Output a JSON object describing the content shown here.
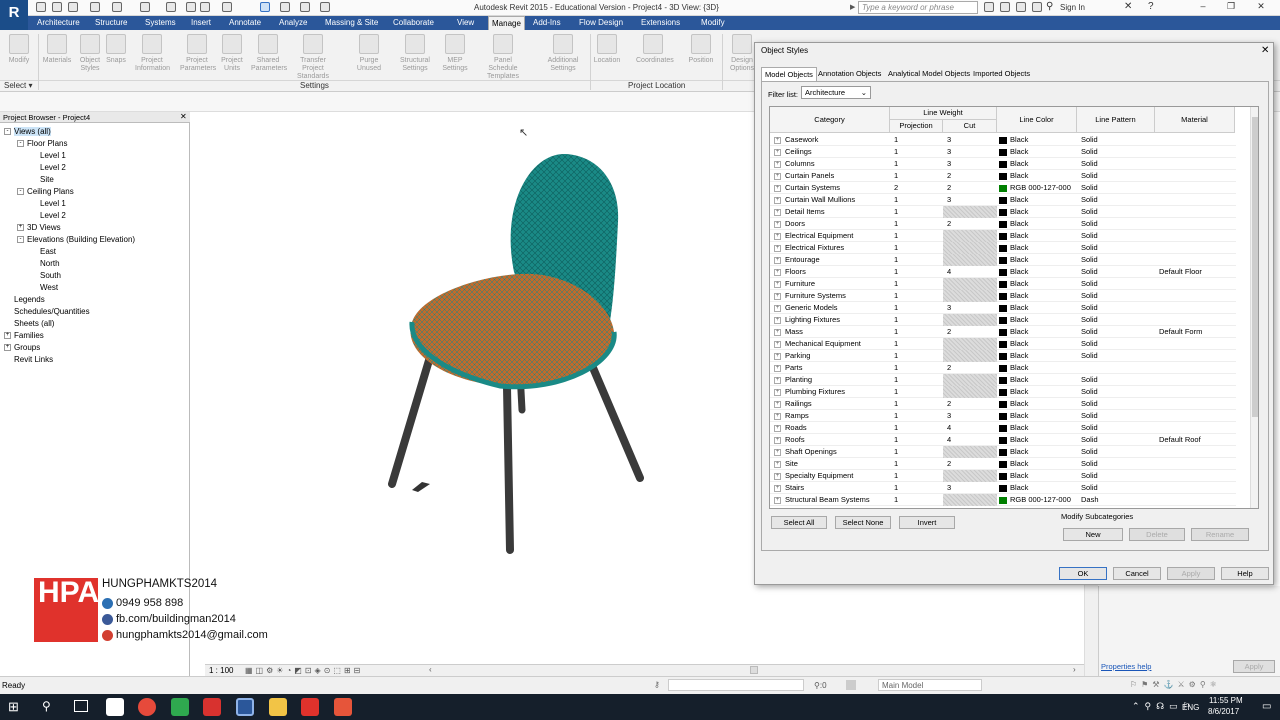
{
  "app": {
    "title": "Autodesk Revit 2015 - Educational Version -     Project4 - 3D View: {3D}",
    "search_placeholder": "Type a keyword or phrase",
    "sign_in": "Sign In",
    "logo_letter": "R"
  },
  "tabs": [
    "Architecture",
    "Structure",
    "Systems",
    "Insert",
    "Annotate",
    "Analyze",
    "Massing & Site",
    "Collaborate",
    "View",
    "Manage",
    "Add-Ins",
    "Flow Design",
    "Extensions",
    "Modify"
  ],
  "active_tab": "Manage",
  "ribbon": {
    "tools": [
      "Modify",
      "Materials",
      "Object Styles",
      "Snaps",
      "Project Information",
      "Project Parameters",
      "Project Units",
      "Shared Parameters",
      "Transfer Project Standards",
      "Purge Unused",
      "Structural Settings",
      "MEP Settings",
      "Panel Schedule Templates",
      "Additional Settings",
      "Location",
      "Coordinates",
      "Position",
      "Design Options"
    ],
    "select_label": "Select",
    "group_settings": "Settings",
    "group_location": "Project Location"
  },
  "project_browser": {
    "title": "Project Browser - Project4",
    "items": [
      {
        "label": "Views (all)",
        "level": 0,
        "exp": "-",
        "selected": true
      },
      {
        "label": "Floor Plans",
        "level": 1,
        "exp": "-"
      },
      {
        "label": "Level 1",
        "level": 2
      },
      {
        "label": "Level 2",
        "level": 2
      },
      {
        "label": "Site",
        "level": 2
      },
      {
        "label": "Ceiling Plans",
        "level": 1,
        "exp": "-"
      },
      {
        "label": "Level 1",
        "level": 2
      },
      {
        "label": "Level 2",
        "level": 2
      },
      {
        "label": "3D Views",
        "level": 1,
        "exp": "+"
      },
      {
        "label": "Elevations (Building Elevation)",
        "level": 1,
        "exp": "-"
      },
      {
        "label": "East",
        "level": 2
      },
      {
        "label": "North",
        "level": 2
      },
      {
        "label": "South",
        "level": 2
      },
      {
        "label": "West",
        "level": 2
      },
      {
        "label": "Legends",
        "level": 0
      },
      {
        "label": "Schedules/Quantities",
        "level": 0
      },
      {
        "label": "Sheets (all)",
        "level": 0
      },
      {
        "label": "Families",
        "level": 0,
        "exp": "+"
      },
      {
        "label": "Groups",
        "level": 0,
        "exp": "+"
      },
      {
        "label": "Revit Links",
        "level": 0
      }
    ]
  },
  "watermark": {
    "logo_text": "HPA",
    "name": "HUNGPHAMKTS2014",
    "phone": "0949 958 898",
    "facebook": "fb.com/buildingman2014",
    "email": "hungphamkts2014@gmail.com"
  },
  "view_bar": {
    "scale": "1 : 100"
  },
  "properties_help": "Properties help",
  "apply_label": "Apply",
  "status": {
    "text": "Ready",
    "zero": ":0",
    "model": "Main Model"
  },
  "taskbar": {
    "lang": "ENG",
    "time": "11:55 PM",
    "date": "8/6/2017"
  },
  "dialog": {
    "title": "Object Styles",
    "tabs": [
      "Model Objects",
      "Annotation Objects",
      "Analytical Model Objects",
      "Imported Objects"
    ],
    "filter_label": "Filter list:",
    "filter_value": "Architecture",
    "columns": {
      "category": "Category",
      "line_weight": "Line Weight",
      "projection": "Projection",
      "cut": "Cut",
      "line_color": "Line Color",
      "line_pattern": "Line Pattern",
      "material": "Material"
    },
    "rows": [
      {
        "category": "Casework",
        "projection": "1",
        "cut": "3",
        "color": "Black",
        "color_hex": "#000000",
        "pattern": "Solid",
        "material": ""
      },
      {
        "category": "Ceilings",
        "projection": "1",
        "cut": "3",
        "color": "Black",
        "color_hex": "#000000",
        "pattern": "Solid",
        "material": ""
      },
      {
        "category": "Columns",
        "projection": "1",
        "cut": "3",
        "color": "Black",
        "color_hex": "#000000",
        "pattern": "Solid",
        "material": ""
      },
      {
        "category": "Curtain Panels",
        "projection": "1",
        "cut": "2",
        "color": "Black",
        "color_hex": "#000000",
        "pattern": "Solid",
        "material": ""
      },
      {
        "category": "Curtain Systems",
        "projection": "2",
        "cut": "2",
        "color": "RGB 000-127-000",
        "color_hex": "#007f00",
        "pattern": "Solid",
        "material": ""
      },
      {
        "category": "Curtain Wall Mullions",
        "projection": "1",
        "cut": "3",
        "color": "Black",
        "color_hex": "#000000",
        "pattern": "Solid",
        "material": ""
      },
      {
        "category": "Detail Items",
        "projection": "1",
        "cut": "",
        "color": "Black",
        "color_hex": "#000000",
        "pattern": "Solid",
        "material": ""
      },
      {
        "category": "Doors",
        "projection": "1",
        "cut": "2",
        "color": "Black",
        "color_hex": "#000000",
        "pattern": "Solid",
        "material": ""
      },
      {
        "category": "Electrical Equipment",
        "projection": "1",
        "cut": "",
        "color": "Black",
        "color_hex": "#000000",
        "pattern": "Solid",
        "material": ""
      },
      {
        "category": "Electrical Fixtures",
        "projection": "1",
        "cut": "",
        "color": "Black",
        "color_hex": "#000000",
        "pattern": "Solid",
        "material": ""
      },
      {
        "category": "Entourage",
        "projection": "1",
        "cut": "",
        "color": "Black",
        "color_hex": "#000000",
        "pattern": "Solid",
        "material": ""
      },
      {
        "category": "Floors",
        "projection": "1",
        "cut": "4",
        "color": "Black",
        "color_hex": "#000000",
        "pattern": "Solid",
        "material": "Default Floor"
      },
      {
        "category": "Furniture",
        "projection": "1",
        "cut": "",
        "color": "Black",
        "color_hex": "#000000",
        "pattern": "Solid",
        "material": ""
      },
      {
        "category": "Furniture Systems",
        "projection": "1",
        "cut": "",
        "color": "Black",
        "color_hex": "#000000",
        "pattern": "Solid",
        "material": ""
      },
      {
        "category": "Generic Models",
        "projection": "1",
        "cut": "3",
        "color": "Black",
        "color_hex": "#000000",
        "pattern": "Solid",
        "material": ""
      },
      {
        "category": "Lighting Fixtures",
        "projection": "1",
        "cut": "",
        "color": "Black",
        "color_hex": "#000000",
        "pattern": "Solid",
        "material": ""
      },
      {
        "category": "Mass",
        "projection": "1",
        "cut": "2",
        "color": "Black",
        "color_hex": "#000000",
        "pattern": "Solid",
        "material": "Default Form"
      },
      {
        "category": "Mechanical Equipment",
        "projection": "1",
        "cut": "",
        "color": "Black",
        "color_hex": "#000000",
        "pattern": "Solid",
        "material": ""
      },
      {
        "category": "Parking",
        "projection": "1",
        "cut": "",
        "color": "Black",
        "color_hex": "#000000",
        "pattern": "Solid",
        "material": ""
      },
      {
        "category": "Parts",
        "projection": "1",
        "cut": "2",
        "color": "Black",
        "color_hex": "#000000",
        "pattern": "",
        "material": ""
      },
      {
        "category": "Planting",
        "projection": "1",
        "cut": "",
        "color": "Black",
        "color_hex": "#000000",
        "pattern": "Solid",
        "material": ""
      },
      {
        "category": "Plumbing Fixtures",
        "projection": "1",
        "cut": "",
        "color": "Black",
        "color_hex": "#000000",
        "pattern": "Solid",
        "material": ""
      },
      {
        "category": "Railings",
        "projection": "1",
        "cut": "2",
        "color": "Black",
        "color_hex": "#000000",
        "pattern": "Solid",
        "material": ""
      },
      {
        "category": "Ramps",
        "projection": "1",
        "cut": "3",
        "color": "Black",
        "color_hex": "#000000",
        "pattern": "Solid",
        "material": ""
      },
      {
        "category": "Roads",
        "projection": "1",
        "cut": "4",
        "color": "Black",
        "color_hex": "#000000",
        "pattern": "Solid",
        "material": ""
      },
      {
        "category": "Roofs",
        "projection": "1",
        "cut": "4",
        "color": "Black",
        "color_hex": "#000000",
        "pattern": "Solid",
        "material": "Default Roof"
      },
      {
        "category": "Shaft Openings",
        "projection": "1",
        "cut": "",
        "color": "Black",
        "color_hex": "#000000",
        "pattern": "Solid",
        "material": ""
      },
      {
        "category": "Site",
        "projection": "1",
        "cut": "2",
        "color": "Black",
        "color_hex": "#000000",
        "pattern": "Solid",
        "material": ""
      },
      {
        "category": "Specialty Equipment",
        "projection": "1",
        "cut": "",
        "color": "Black",
        "color_hex": "#000000",
        "pattern": "Solid",
        "material": ""
      },
      {
        "category": "Stairs",
        "projection": "1",
        "cut": "3",
        "color": "Black",
        "color_hex": "#000000",
        "pattern": "Solid",
        "material": ""
      },
      {
        "category": "Structural Beam Systems",
        "projection": "1",
        "cut": "",
        "color": "RGB 000-127-000",
        "color_hex": "#007f00",
        "pattern": "Dash",
        "material": ""
      }
    ],
    "buttons": {
      "select_all": "Select All",
      "select_none": "Select None",
      "invert": "Invert"
    },
    "modify_sub": {
      "title": "Modify Subcategories",
      "new": "New",
      "delete": "Delete",
      "rename": "Rename"
    },
    "footer": {
      "ok": "OK",
      "cancel": "Cancel",
      "apply": "Apply",
      "help": "Help"
    }
  },
  "colors": {
    "tab_bar": "#2b579a",
    "chair_shell": "#1a8a86",
    "chair_seat": "#c26a2c",
    "chair_legs": "#3a3a3a",
    "logo_red": "#e0322c"
  }
}
